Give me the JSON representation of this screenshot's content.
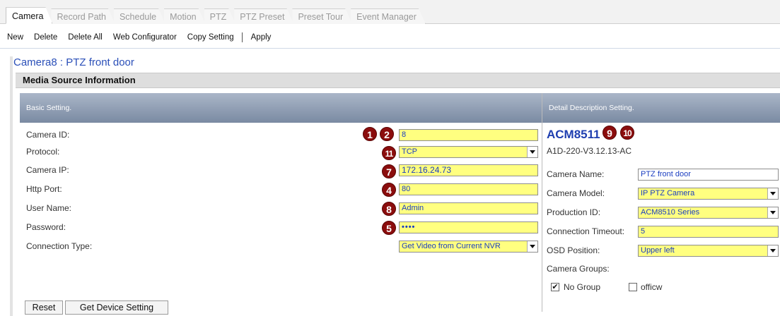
{
  "tabs": [
    {
      "label": "Camera",
      "active": true
    },
    {
      "label": "Record Path",
      "active": false
    },
    {
      "label": "Schedule",
      "active": false
    },
    {
      "label": "Motion",
      "active": false
    },
    {
      "label": "PTZ",
      "active": false
    },
    {
      "label": "PTZ Preset",
      "active": false
    },
    {
      "label": "Preset Tour",
      "active": false
    },
    {
      "label": "Event Manager",
      "active": false
    }
  ],
  "toolbar": {
    "new": "New",
    "delete": "Delete",
    "delete_all": "Delete All",
    "web_configurator": "Web Configurator",
    "copy_setting": "Copy Setting",
    "apply": "Apply"
  },
  "camera_title": "Camera8  : PTZ front door",
  "section_title": "Media Source Information",
  "basic_header": "Basic Setting.",
  "detail_header": "Detail Description Setting.",
  "basic": {
    "camera_id_label": "Camera ID:",
    "camera_id_value": "8",
    "protocol_label": "Protocol:",
    "protocol_value": "TCP",
    "camera_ip_label": "Camera IP:",
    "camera_ip_value": "172.16.24.73",
    "http_port_label": "Http Port:",
    "http_port_value": "80",
    "user_name_label": "User Name:",
    "user_name_value": "Admin",
    "password_label": "Password:",
    "password_value": "••••",
    "connection_type_label": "Connection Type:",
    "connection_type_value": "Get Video from Current NVR"
  },
  "detail": {
    "model_name": "ACM8511",
    "firmware": "A1D-220-V3.12.13-AC",
    "camera_name_label": "Camera Name:",
    "camera_name_value": "PTZ front door",
    "camera_model_label": "Camera Model:",
    "camera_model_value": "IP PTZ Camera",
    "production_id_label": "Production ID:",
    "production_id_value": "ACM8510 Series",
    "connection_timeout_label": "Connection Timeout:",
    "connection_timeout_value": "5",
    "osd_position_label": "OSD Position:",
    "osd_position_value": "Upper left",
    "camera_groups_label": "Camera Groups:",
    "groups": [
      {
        "label": "No Group",
        "checked": true
      },
      {
        "label": "officw",
        "checked": false
      }
    ]
  },
  "badges": {
    "b1": "1",
    "b2": "2",
    "b11": "11",
    "b7": "7",
    "b4": "4",
    "b8": "8",
    "b5": "5",
    "b9": "9",
    "b10": "10"
  },
  "buttons": {
    "reset": "Reset",
    "get_device_setting": "Get Device Setting"
  },
  "colors": {
    "field_highlight": "#ffff80",
    "badge": "#8b0d0d",
    "link_blue": "#1f3fb0"
  }
}
